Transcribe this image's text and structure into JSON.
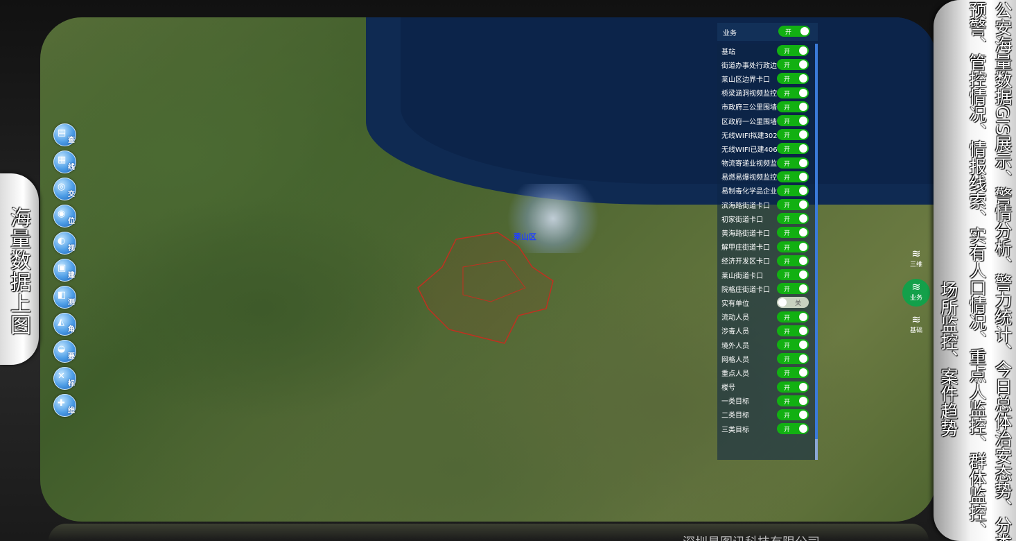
{
  "left_tab": {
    "text": "海量数据上图"
  },
  "tools": [
    {
      "icon": "table-icon",
      "glyph": "▤",
      "label": "查"
    },
    {
      "icon": "grid-icon",
      "glyph": "▦",
      "label": "线"
    },
    {
      "icon": "map-icon",
      "glyph": "◎",
      "label": "交"
    },
    {
      "icon": "location-icon",
      "glyph": "◉",
      "label": "位"
    },
    {
      "icon": "camera-icon",
      "glyph": "◐",
      "label": "视"
    },
    {
      "icon": "building-icon",
      "glyph": "▣",
      "label": "建"
    },
    {
      "icon": "layers-icon",
      "glyph": "◧",
      "label": "测"
    },
    {
      "icon": "angle-icon",
      "glyph": "◭",
      "label": "角"
    },
    {
      "icon": "road-icon",
      "glyph": "◒",
      "label": "要"
    },
    {
      "icon": "tools-icon",
      "glyph": "✕",
      "label": "标"
    },
    {
      "icon": "wrench-icon",
      "glyph": "✚",
      "label": "维"
    }
  ],
  "map": {
    "region_label": "莱山区"
  },
  "layer_panel": {
    "header": {
      "label": "业务",
      "toggle": "开"
    },
    "rows": [
      {
        "name": "基站",
        "state": "开"
      },
      {
        "name": "街道办事处行政边",
        "state": "开"
      },
      {
        "name": "莱山区边界卡口",
        "state": "开"
      },
      {
        "name": "桥梁涵洞视频监控",
        "state": "开"
      },
      {
        "name": "市政府三公里围墙",
        "state": "开"
      },
      {
        "name": "区政府一公里围墙",
        "state": "开"
      },
      {
        "name": "无线WIFI拟建302",
        "state": "开"
      },
      {
        "name": "无线WIFI已建406",
        "state": "开"
      },
      {
        "name": "物流寄递业视频监",
        "state": "开"
      },
      {
        "name": "易燃易爆视频监控",
        "state": "开"
      },
      {
        "name": "易制毒化学品企业",
        "state": "开"
      },
      {
        "name": "滨海路街道卡口",
        "state": "开"
      },
      {
        "name": "初家街道卡口",
        "state": "开"
      },
      {
        "name": "黄海路街道卡口",
        "state": "开"
      },
      {
        "name": "解甲庄街道卡口",
        "state": "开"
      },
      {
        "name": "经济开发区卡口",
        "state": "开"
      },
      {
        "name": "莱山街道卡口",
        "state": "开"
      },
      {
        "name": "院格庄街道卡口",
        "state": "开"
      },
      {
        "name": "实有单位",
        "state": "关"
      },
      {
        "name": "流动人员",
        "state": "开"
      },
      {
        "name": "涉毒人员",
        "state": "开"
      },
      {
        "name": "境外人员",
        "state": "开"
      },
      {
        "name": "网格人员",
        "state": "开"
      },
      {
        "name": "重点人员",
        "state": "开"
      },
      {
        "name": "楼号",
        "state": "开"
      },
      {
        "name": "一类目标",
        "state": "开"
      },
      {
        "name": "二类目标",
        "state": "开"
      },
      {
        "name": "三类目标",
        "state": "开"
      }
    ]
  },
  "mini_controls": {
    "threed": "三维",
    "business": "业务",
    "base": "基础"
  },
  "right_strip": {
    "col1": "公安海量数据GIS展示、警情分析、警力统计、今日总体治安态势、分类",
    "col2": "预警、管控情况、情报线索、实有人口情况、重点人监控、群体监控、",
    "col3": "场所监控、案件趋势"
  },
  "footer": {
    "text": "深圳易图讯科技有限公司"
  }
}
